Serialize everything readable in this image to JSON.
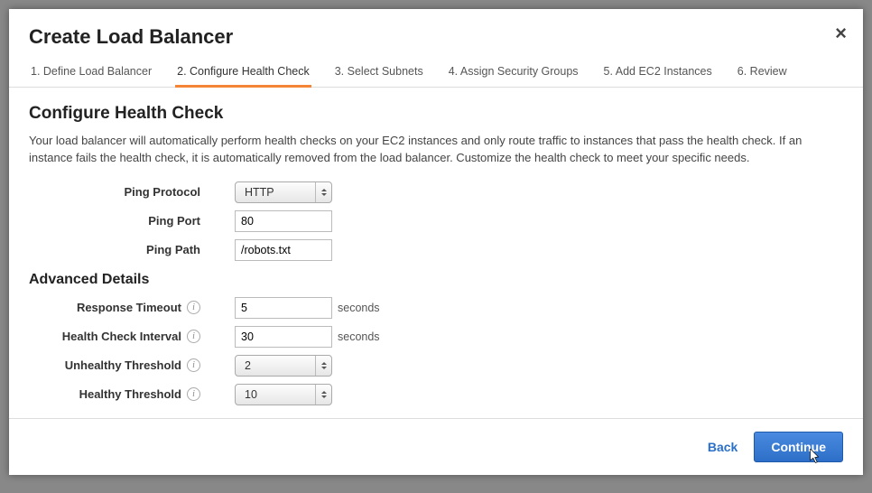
{
  "modal": {
    "title": "Create Load Balancer",
    "close_label": "×"
  },
  "tabs": [
    {
      "label": "1. Define Load Balancer"
    },
    {
      "label": "2. Configure Health Check"
    },
    {
      "label": "3. Select Subnets"
    },
    {
      "label": "4. Assign Security Groups"
    },
    {
      "label": "5. Add EC2 Instances"
    },
    {
      "label": "6. Review"
    }
  ],
  "section": {
    "title": "Configure Health Check",
    "description": "Your load balancer will automatically perform health checks on your EC2 instances and only route traffic to instances that pass the health check. If an instance fails the health check, it is automatically removed from the load balancer. Customize the health check to meet your specific needs."
  },
  "fields": {
    "ping_protocol": {
      "label": "Ping Protocol",
      "value": "HTTP"
    },
    "ping_port": {
      "label": "Ping Port",
      "value": "80"
    },
    "ping_path": {
      "label": "Ping Path",
      "value": "/robots.txt"
    }
  },
  "advanced": {
    "title": "Advanced Details",
    "response_timeout": {
      "label": "Response Timeout",
      "value": "5",
      "unit": "seconds"
    },
    "health_check_interval": {
      "label": "Health Check Interval",
      "value": "30",
      "unit": "seconds"
    },
    "unhealthy_threshold": {
      "label": "Unhealthy Threshold",
      "value": "2"
    },
    "healthy_threshold": {
      "label": "Healthy Threshold",
      "value": "10"
    }
  },
  "footer": {
    "back_label": "Back",
    "continue_label": "Continue"
  }
}
